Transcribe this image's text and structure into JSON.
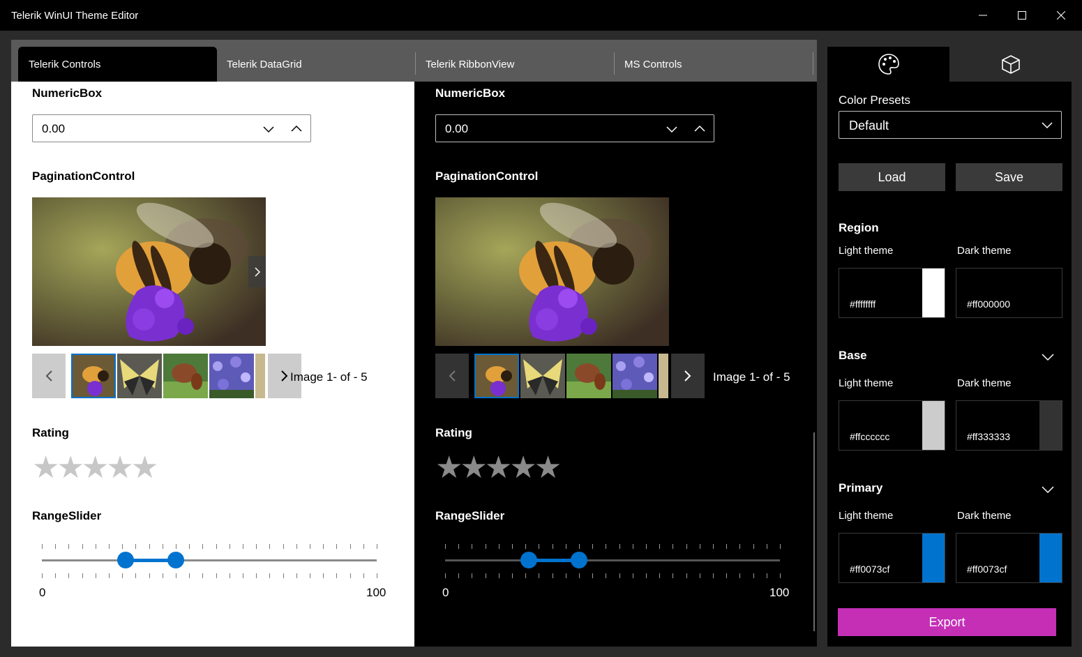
{
  "window": {
    "title": "Telerik WinUI Theme Editor"
  },
  "tabs": [
    "Telerik Controls",
    "Telerik DataGrid",
    "Telerik RibbonView",
    "MS Controls"
  ],
  "preview": {
    "numericbox_title": "NumericBox",
    "numericbox_value": "0.00",
    "pagination_title": "PaginationControl",
    "pagination_text": "Image 1- of - 5",
    "rating_title": "Rating",
    "rating_value": 0,
    "rating_max": 5,
    "rangeslider_title": "RangeSlider",
    "slider_min_label": "0",
    "slider_max_label": "100",
    "slider_range_fraction": [
      0.25,
      0.4
    ]
  },
  "side": {
    "tab_icons": [
      "palette-icon",
      "cube-icon"
    ],
    "color_presets_label": "Color Presets",
    "color_presets_value": "Default",
    "load_label": "Load",
    "save_label": "Save",
    "light_label": "Light theme",
    "dark_label": "Dark theme",
    "region": {
      "title": "Region",
      "light_hex": "#ffffffff",
      "dark_hex": "#ff000000",
      "light_color": "#ffffff",
      "dark_color": "#000000"
    },
    "base": {
      "title": "Base",
      "light_hex": "#ffcccccc",
      "dark_hex": "#ff333333",
      "light_color": "#cccccc",
      "dark_color": "#333333"
    },
    "primary": {
      "title": "Primary",
      "light_hex": "#ff0073cf",
      "dark_hex": "#ff0073cf",
      "light_color": "#0073cf",
      "dark_color": "#0073cf"
    },
    "export_label": "Export"
  },
  "colors": {
    "accent": "#0073cf",
    "export": "#c42fb6"
  }
}
